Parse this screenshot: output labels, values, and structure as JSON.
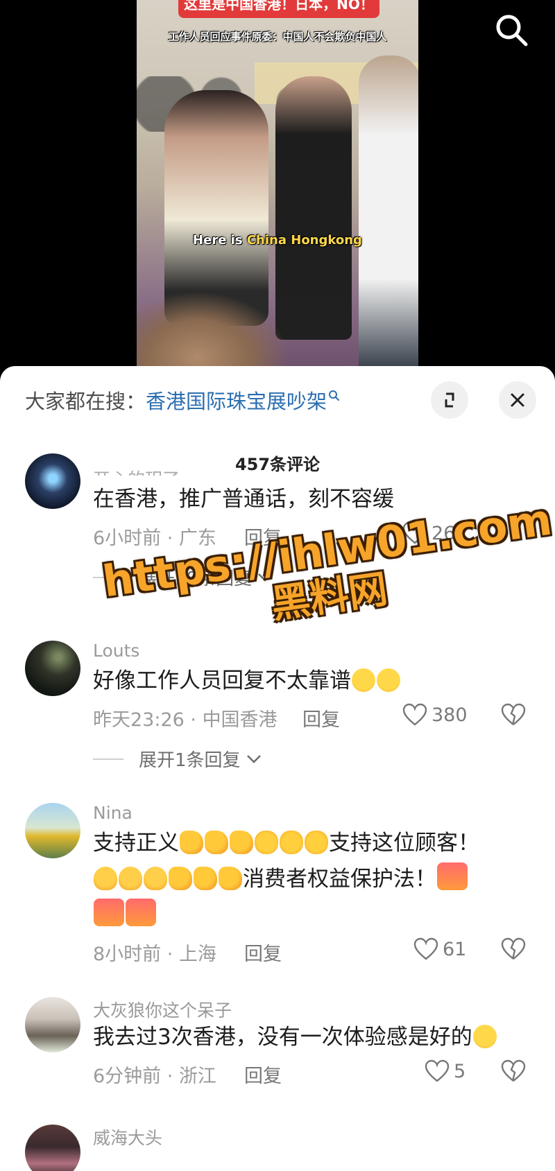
{
  "video": {
    "banner_title": "这里是中国香港！日本，NO！",
    "subtitle_top": "工作人员回应事件原委：中国人不会欺负中国人",
    "caption_white": "Here is ",
    "caption_yellow": "China Hongkong"
  },
  "search_hint": {
    "prefix": "大家都在搜：",
    "query": "香港国际珠宝展吵架"
  },
  "comment_count": "457条评论",
  "comments": [
    {
      "name": "开心的玥了",
      "text": "在香港，推广普通话，刻不容缓",
      "time": "6小时前",
      "location": "广东",
      "reply": "回复",
      "likes": "262",
      "expand": "展开19条回复"
    },
    {
      "name": "Louts",
      "text": "好像工作人员回复不太靠谱",
      "time": "昨天23:26",
      "location": "中国香港",
      "reply": "回复",
      "likes": "380",
      "expand": "展开1条回复"
    },
    {
      "name": "Nina",
      "text_a": "支持正义",
      "text_b": "支持这位顾客！",
      "text_c": "消费者权益保护法！",
      "time": "8小时前",
      "location": "上海",
      "reply": "回复",
      "likes": "61"
    },
    {
      "name": "大灰狼你这个呆子",
      "text": "我去过3次香港，没有一次体验感是好的",
      "time": "6分钟前",
      "location": "浙江",
      "reply": "回复",
      "likes": "5"
    },
    {
      "name": "威海大头"
    }
  ],
  "watermark": {
    "line1": "https://ihlw01.com",
    "line2": "黑料网"
  },
  "meta_separator": " · ",
  "colors": {
    "link_blue": "#2b6eb0",
    "watermark_orange": "#f6a42a",
    "banner_red": "#e23a3a",
    "caption_yellow": "#ffd84a"
  }
}
